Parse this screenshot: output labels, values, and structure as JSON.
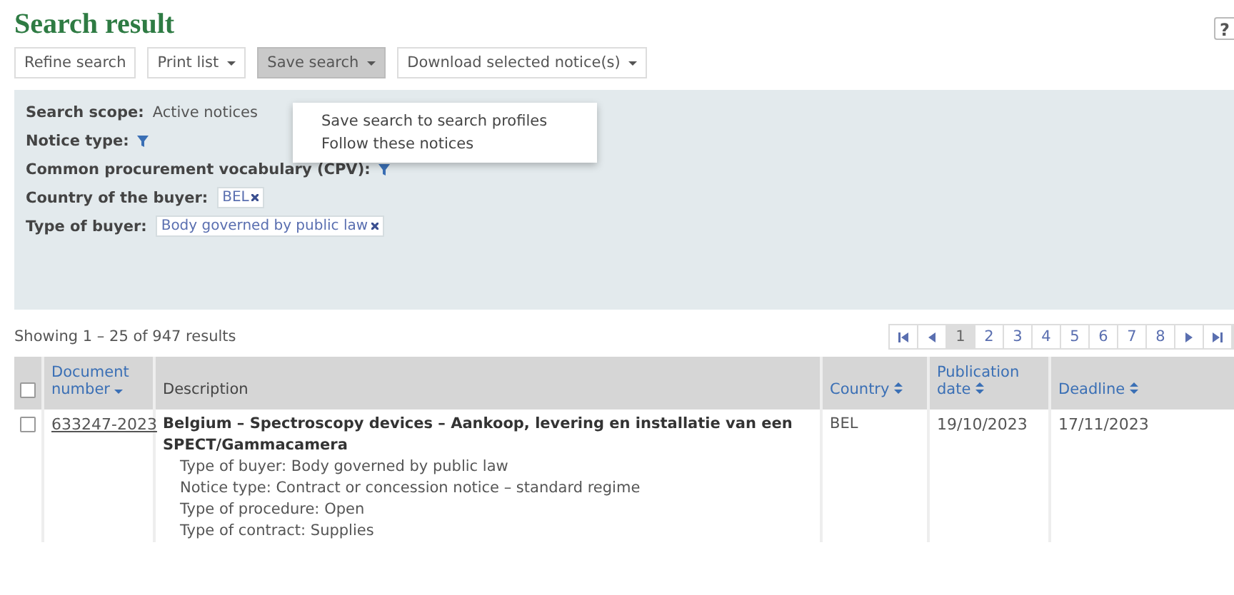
{
  "title": "Search result",
  "help": "?",
  "toolbar": [
    {
      "label": "Refine search",
      "dropdown": false,
      "selected": false
    },
    {
      "label": "Print list",
      "dropdown": true,
      "selected": false
    },
    {
      "label": "Save search",
      "dropdown": true,
      "selected": true
    },
    {
      "label": "Download selected notice(s)",
      "dropdown": true,
      "selected": false
    }
  ],
  "menu": {
    "items": [
      "Save search to search profiles",
      "Follow these notices"
    ]
  },
  "filters": [
    {
      "kind": "text",
      "label": "Search scope:",
      "value": "Active notices"
    },
    {
      "kind": "funnel",
      "label": "Notice type:"
    },
    {
      "kind": "funnel",
      "label": "Common procurement vocabulary (CPV):"
    },
    {
      "kind": "tag",
      "label": "Country of the buyer:",
      "value": "BEL"
    },
    {
      "kind": "tag",
      "label": "Type of buyer:",
      "value": "Body governed by public law"
    }
  ],
  "summary": "Showing 1 – 25 of 947 results",
  "pager": {
    "pages": [
      {
        "label": "1",
        "selected": true
      },
      {
        "label": "2",
        "selected": false
      },
      {
        "label": "3",
        "selected": false
      },
      {
        "label": "4",
        "selected": false
      },
      {
        "label": "5",
        "selected": false
      },
      {
        "label": "6",
        "selected": false
      },
      {
        "label": "7",
        "selected": false
      },
      {
        "label": "8",
        "selected": false
      }
    ]
  },
  "table": {
    "header_checked": false,
    "columns": [
      {
        "label": "Document number",
        "sortable": true,
        "sorted": true
      },
      {
        "label": "Description",
        "sortable": false
      },
      {
        "label": "Country",
        "sortable": true,
        "sorted": false
      },
      {
        "label": "Publication date",
        "sortable": true,
        "sorted": false
      },
      {
        "label": "Deadline",
        "sortable": true,
        "sorted": false
      }
    ],
    "rows": [
      {
        "checked": false,
        "number": "633247-2023",
        "title": "Belgium – Spectroscopy devices – Aankoop, levering en installatie van een SPECT/Gammacamera",
        "details": [
          "Type of buyer: Body governed by public law",
          "Notice type: Contract or concession notice – standard regime",
          "Type of procedure: Open",
          "Type of contract: Supplies"
        ],
        "country": "BEL",
        "publication_date": "19/10/2023",
        "deadline": "17/11/2023"
      }
    ]
  }
}
